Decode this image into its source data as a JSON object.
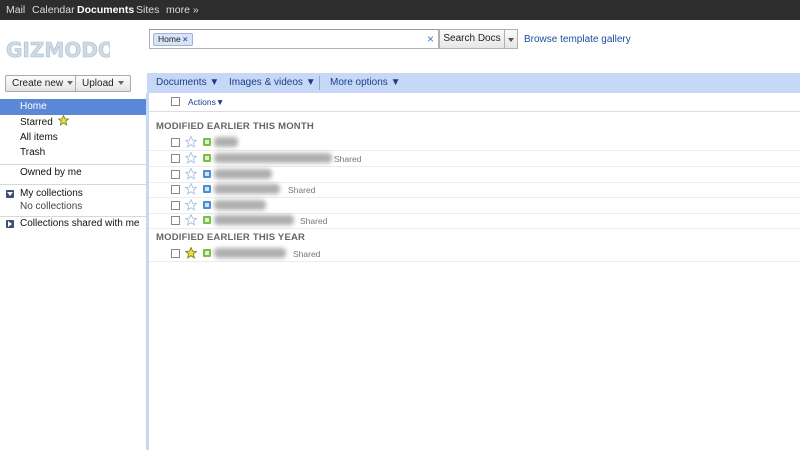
{
  "topbar": {
    "items": [
      "Mail",
      "Calendar",
      "Documents",
      "Sites",
      "more »"
    ],
    "active": "Documents"
  },
  "header": {
    "logo": "GIZMODO",
    "search_chip": "Home",
    "search_value": "",
    "search_button": "Search Docs",
    "template_link": "Browse template gallery"
  },
  "buttons": {
    "create_new": "Create new",
    "upload": "Upload"
  },
  "toolbar": {
    "documents": "Documents ▼",
    "images_videos": "Images & videos ▼",
    "more_options": "More options ▼"
  },
  "sidebar": {
    "home": "Home",
    "starred": "Starred",
    "all_items": "All items",
    "trash": "Trash",
    "owned_by_me": "Owned by me",
    "my_collections": "My collections",
    "no_collections": "No collections",
    "shared_collections": "Collections shared with me"
  },
  "list": {
    "actions": "Actions▼",
    "sections": [
      {
        "title": "MODIFIED EARLIER THIS MONTH",
        "rows": [
          {
            "name": "",
            "shared": "",
            "type": "spreadsheet",
            "starred": false
          },
          {
            "name": "",
            "shared": "Shared",
            "type": "spreadsheet",
            "starred": false
          },
          {
            "name": "",
            "shared": "",
            "type": "document",
            "starred": false
          },
          {
            "name": "",
            "shared": "Shared",
            "type": "document",
            "starred": false
          },
          {
            "name": "",
            "shared": "",
            "type": "document",
            "starred": false
          },
          {
            "name": "",
            "shared": "Shared",
            "type": "spreadsheet",
            "starred": false
          }
        ]
      },
      {
        "title": "MODIFIED EARLIER THIS YEAR",
        "rows": [
          {
            "name": "",
            "shared": "Shared",
            "type": "spreadsheet",
            "starred": true
          }
        ]
      }
    ]
  },
  "colors": {
    "topbar": "#2d2d2d",
    "toolbar": "#c6d8f6",
    "selected": "#5a87d6",
    "spreadsheet_icon": "#7ac143",
    "document_icon": "#4a90d9",
    "star_on": "#f4d84a"
  },
  "icons": {
    "star": "star-icon",
    "spreadsheet": "spreadsheet-icon",
    "document": "document-icon",
    "clear": "clear-icon"
  }
}
